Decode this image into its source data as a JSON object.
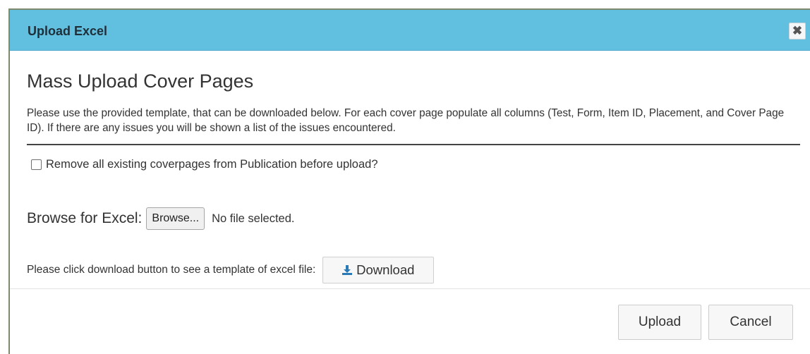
{
  "dialog": {
    "title": "Upload Excel",
    "close_glyph": "✖",
    "close_icon": "close-icon"
  },
  "content": {
    "heading": "Mass Upload Cover Pages",
    "description": "Please use the provided template, that can be downloaded below. For each cover page populate all columns (Test, Form, Item ID, Placement, and Cover Page ID). If there are any issues you will be shown a list of the issues encountered.",
    "checkbox": {
      "label": "Remove all existing coverpages from Publication before upload?",
      "checked": false
    },
    "browse": {
      "label": "Browse for Excel:",
      "button_label": "Browse...",
      "file_status": "No file selected."
    },
    "download": {
      "label": "Please click download button to see a template of excel file:",
      "button_label": "Download",
      "icon": "download-icon"
    }
  },
  "footer": {
    "upload_label": "Upload",
    "cancel_label": "Cancel"
  },
  "colors": {
    "titlebar": "#61bfe0",
    "download_icon": "#2a7ab8"
  }
}
